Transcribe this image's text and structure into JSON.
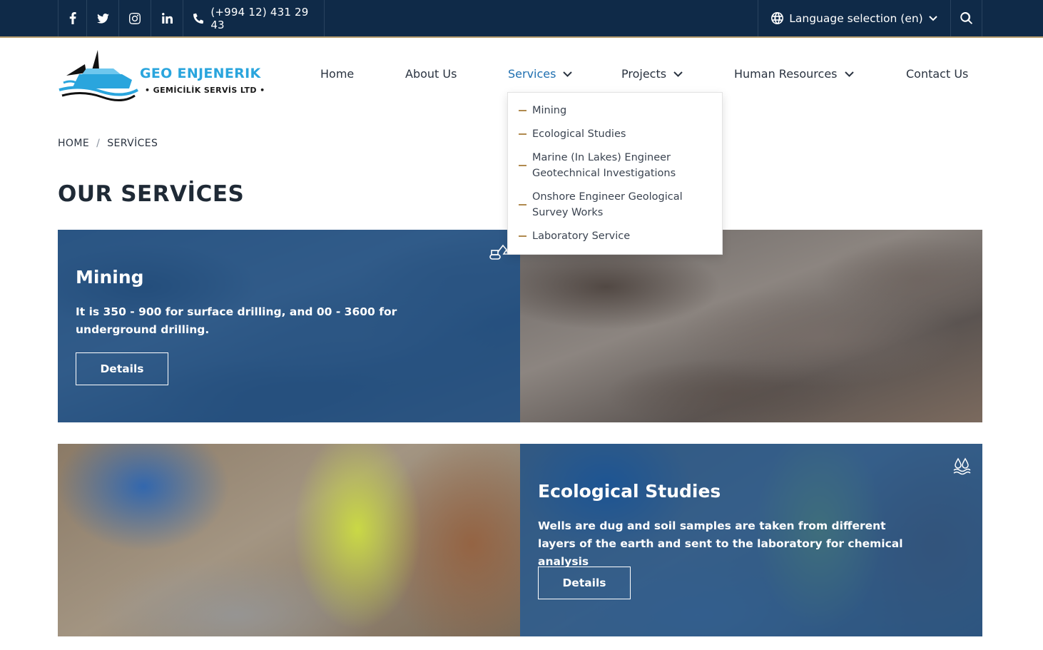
{
  "topbar": {
    "social": [
      "facebook-icon",
      "twitter-icon",
      "instagram-icon",
      "linkedin-icon"
    ],
    "phone": "(+994 12) 431 29 43",
    "language": "Language selection (en)"
  },
  "logo": {
    "title": "GEO ENJENERIK",
    "subtitle": "• GEMİCİLİK SERVİS LTD •"
  },
  "nav": {
    "items": [
      {
        "label": "Home"
      },
      {
        "label": "About Us"
      },
      {
        "label": "Services"
      },
      {
        "label": "Projects"
      },
      {
        "label": "Human Resources"
      },
      {
        "label": "Contact Us"
      }
    ]
  },
  "dropdown": {
    "items": [
      {
        "label": "Mining"
      },
      {
        "label": "Ecological Studies"
      },
      {
        "label": "Marine (In Lakes) Engineer Geotechnical Investigations"
      },
      {
        "label": "Onshore Engineer Geological Survey Works"
      },
      {
        "label": "Laboratory Service"
      }
    ]
  },
  "breadcrumb": {
    "home": "HOME",
    "separator": "/",
    "current": "SERVİCES"
  },
  "page": {
    "title": "OUR SERVİCES"
  },
  "services": [
    {
      "title": "Mining",
      "text": "It is 350 - 900 for surface drilling, and 00 - 3600 for underground drilling.",
      "button": "Details",
      "icon": "excavator-icon"
    },
    {
      "title": "Ecological Studies",
      "text": "Wells are dug and soil samples are taken from different layers of the earth and sent to the laboratory for chemical analysis",
      "button": "Details",
      "icon": "water-drops-icon"
    }
  ],
  "colors": {
    "topbar": "#0f2a48",
    "accent_line": "#b39a6b",
    "nav_active": "#1f6fb0",
    "card_tint": "#17508c",
    "logo_blue": "#2aa5dd"
  }
}
